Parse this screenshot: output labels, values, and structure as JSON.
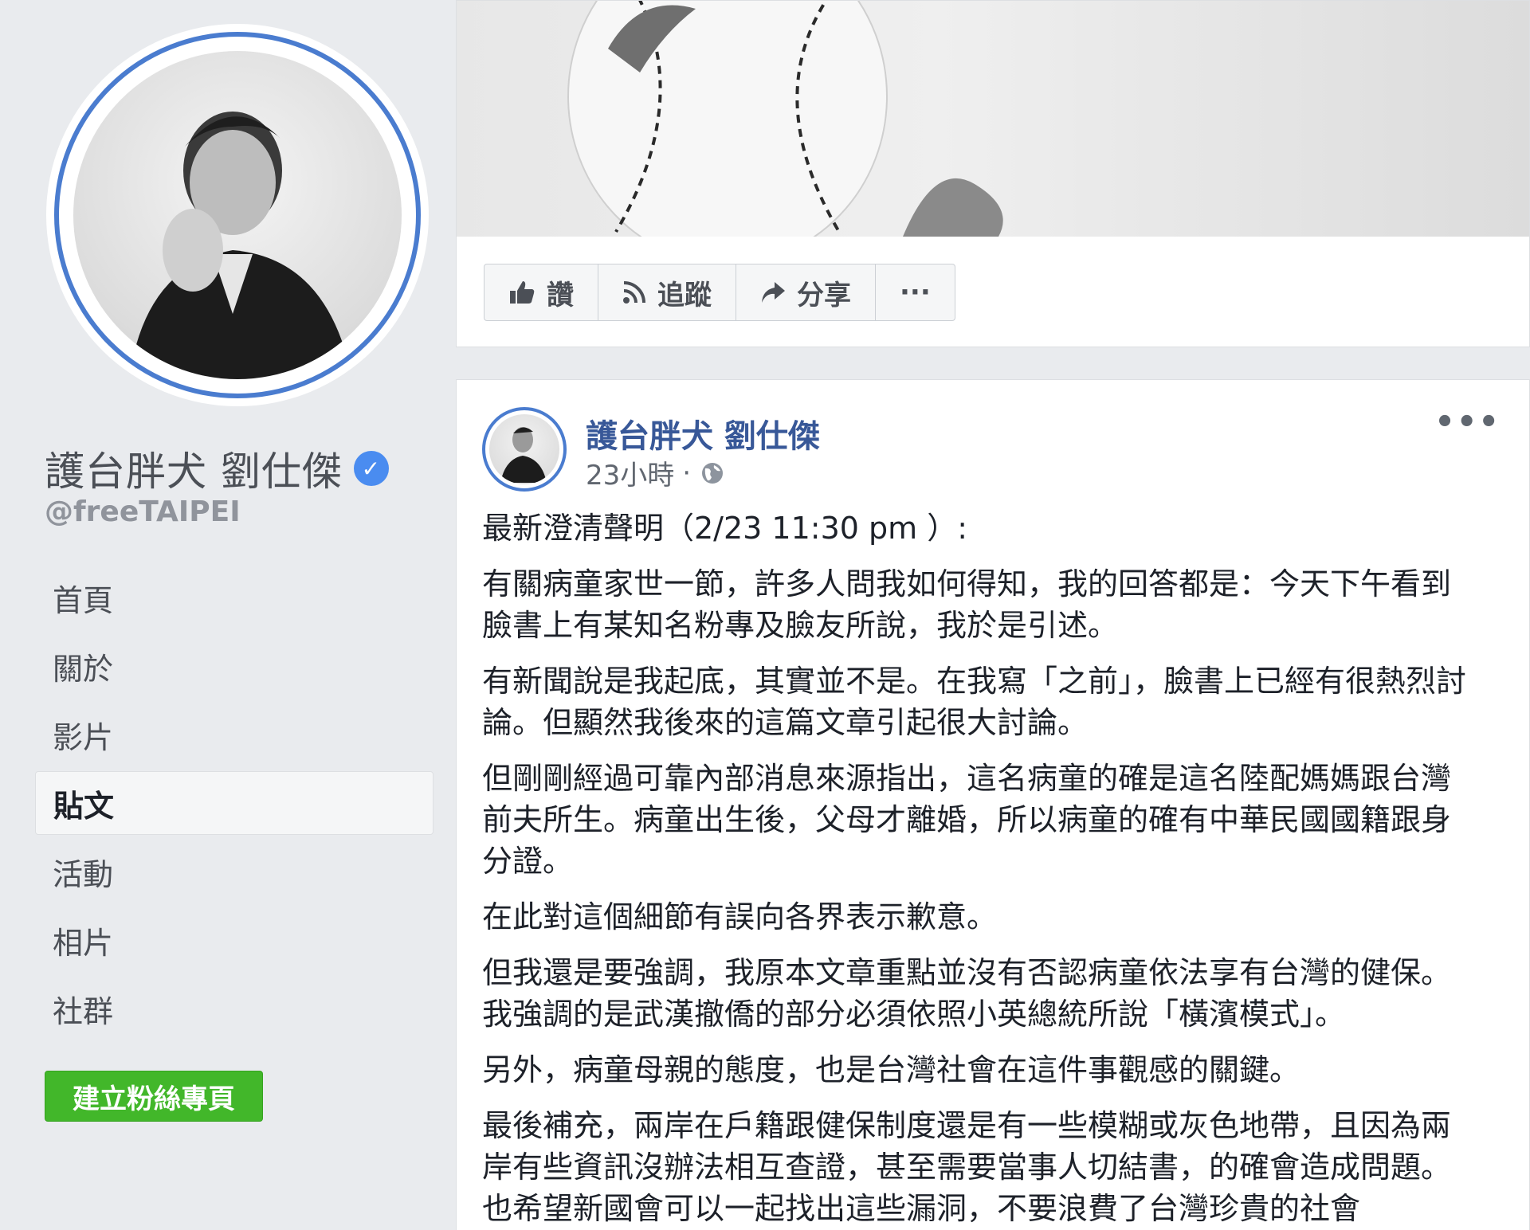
{
  "sidebar": {
    "page_name": "護台胖犬 劉仕傑",
    "verified_icon": "verified-check-icon",
    "handle": "@freeTAIPEI",
    "nav_items": [
      "首頁",
      "關於",
      "影片",
      "貼文",
      "活動",
      "相片",
      "社群"
    ],
    "active_nav": "貼文",
    "create_page_label": "建立粉絲專頁"
  },
  "actions": {
    "like_label": "讚",
    "follow_label": "追蹤",
    "share_label": "分享",
    "more_label": "···"
  },
  "post": {
    "author": "護台胖犬 劉仕傑",
    "time": "23小時",
    "separator": "·",
    "more_label": "•••",
    "paragraphs": [
      "最新澄清聲明（2/23 11:30 pm ）:",
      "有關病童家世一節，許多人問我如何得知，我的回答都是：今天下午看到臉書上有某知名粉專及臉友所說，我於是引述。",
      "有新聞說是我起底，其實並不是。在我寫「之前」，臉書上已經有很熱烈討論。但顯然我後來的這篇文章引起很大討論。",
      "但剛剛經過可靠內部消息來源指出，這名病童的確是這名陸配媽媽跟台灣前夫所生。病童出生後，父母才離婚，所以病童的確有中華民國國籍跟身分證。",
      "在此對這個細節有誤向各界表示歉意。",
      "但我還是要強調，我原本文章重點並沒有否認病童依法享有台灣的健保。我強調的是武漢撤僑的部分必須依照小英總統所說「橫濱模式」。",
      "另外，病童母親的態度，也是台灣社會在這件事觀感的關鍵。",
      "最後補充，兩岸在戶籍跟健保制度還是有一些模糊或灰色地帶，且因為兩岸有些資訊沒辦法相互查證，甚至需要當事人切結書，的確會造成問題。也希望新國會可以一起找出這些漏洞，不要浪費了台灣珍貴的社會"
    ]
  },
  "colors": {
    "background": "#e9ebee",
    "link_blue": "#385898",
    "ring_blue": "#4a7ccf",
    "create_green": "#42b72a"
  }
}
